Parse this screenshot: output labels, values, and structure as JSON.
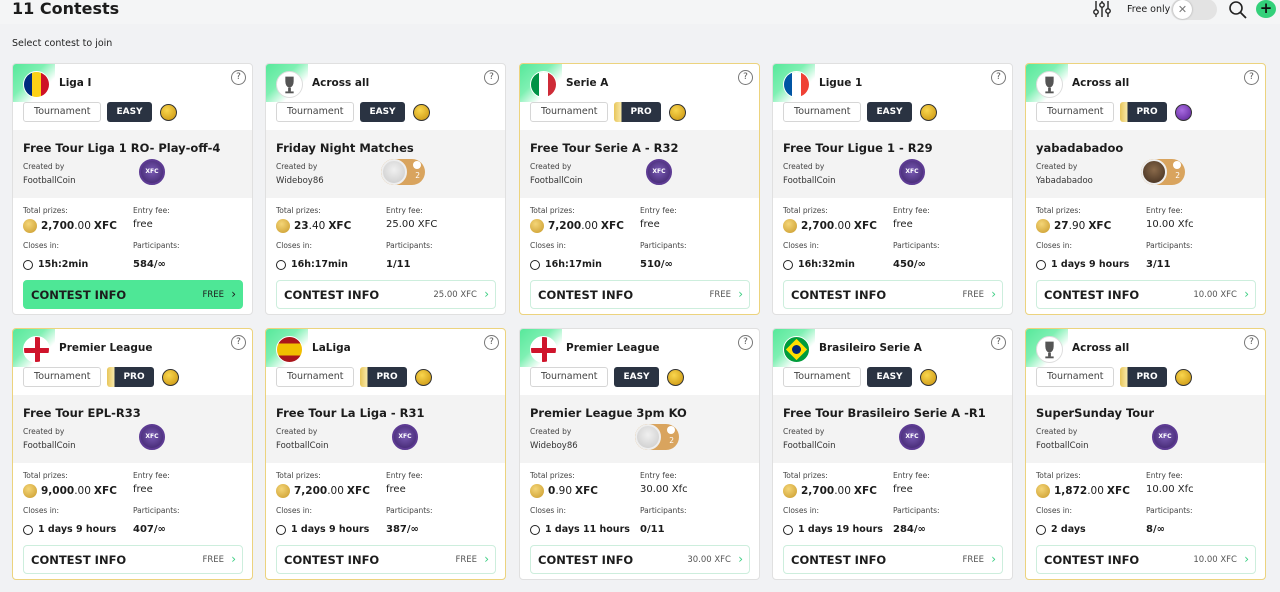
{
  "header": {
    "title": "11 Contests",
    "subtitle": "Select contest to join",
    "free_only_label": "Free only",
    "add_label": "+"
  },
  "labels": {
    "created_by": "Created by",
    "total_prizes": "Total prizes:",
    "entry_fee": "Entry fee:",
    "closes_in": "Closes in:",
    "participants": "Participants:",
    "contest_info": "CONTEST INFO",
    "currency": "XFC",
    "help": "?"
  },
  "contests": [
    {
      "league": "Liga I",
      "flag": "ro",
      "type": "Tournament",
      "level": "EASY",
      "title": "Free Tour Liga 1 RO- Play-off-4",
      "creator": "FootballCoin",
      "avatar": "fc",
      "prize_int": "2,700",
      "prize_dec": ".00",
      "entry_fee": "free",
      "closes": "15h:2min",
      "participants": "584/∞",
      "cta_fee": "FREE",
      "active": true
    },
    {
      "league": "Across all",
      "flag": "cup",
      "type": "Tournament",
      "level": "EASY",
      "title": "Friday Night Matches",
      "creator": "Wideboy86",
      "avatar": "user",
      "avatar_num": "2",
      "prize_int": "23",
      "prize_dec": ".40",
      "entry_fee": "25.00 XFC",
      "closes": "16h:17min",
      "participants": "1/11",
      "cta_fee": "25.00 XFC",
      "active": false
    },
    {
      "league": "Serie A",
      "flag": "it",
      "type": "Tournament",
      "level": "PRO",
      "title": "Free Tour Serie A - R32",
      "creator": "FootballCoin",
      "avatar": "fc",
      "prize_int": "7,200",
      "prize_dec": ".00",
      "entry_fee": "free",
      "closes": "16h:17min",
      "participants": "510/∞",
      "cta_fee": "FREE",
      "active": false
    },
    {
      "league": "Ligue 1",
      "flag": "fr",
      "type": "Tournament",
      "level": "EASY",
      "title": "Free Tour Ligue 1 - R29",
      "creator": "FootballCoin",
      "avatar": "fc",
      "prize_int": "2,700",
      "prize_dec": ".00",
      "entry_fee": "free",
      "closes": "16h:32min",
      "participants": "450/∞",
      "cta_fee": "FREE",
      "active": false
    },
    {
      "league": "Across all",
      "flag": "cup",
      "type": "Tournament",
      "level": "PRO",
      "title": "yabadabadoo",
      "creator": "Yabadabadoo",
      "avatar": "photo",
      "avatar_num": "2",
      "prize_int": "27",
      "prize_dec": ".90",
      "entry_fee": "10.00 Xfc",
      "closes": "1 days 9 hours",
      "participants": "3/11",
      "cta_fee": "10.00 XFC",
      "active": false,
      "purple_badge": true
    },
    {
      "league": "Premier League",
      "flag": "en",
      "type": "Tournament",
      "level": "PRO",
      "title": "Free Tour EPL-R33",
      "creator": "FootballCoin",
      "avatar": "fc",
      "prize_int": "9,000",
      "prize_dec": ".00",
      "entry_fee": "free",
      "closes": "1 days 9 hours",
      "participants": "407/∞",
      "cta_fee": "FREE",
      "active": false
    },
    {
      "league": "LaLiga",
      "flag": "es",
      "type": "Tournament",
      "level": "PRO",
      "title": "Free Tour La Liga - R31",
      "creator": "FootballCoin",
      "avatar": "fc",
      "prize_int": "7,200",
      "prize_dec": ".00",
      "entry_fee": "free",
      "closes": "1 days 9 hours",
      "participants": "387/∞",
      "cta_fee": "FREE",
      "active": false
    },
    {
      "league": "Premier League",
      "flag": "en",
      "type": "Tournament",
      "level": "EASY",
      "title": "Premier League 3pm KO",
      "creator": "Wideboy86",
      "avatar": "user",
      "avatar_num": "2",
      "prize_int": "0",
      "prize_dec": ".90",
      "entry_fee": "30.00 Xfc",
      "closes": "1 days 11 hours",
      "participants": "0/11",
      "cta_fee": "30.00 XFC",
      "active": false
    },
    {
      "league": "Brasileiro Serie A",
      "flag": "br",
      "type": "Tournament",
      "level": "EASY",
      "title": "Free Tour Brasileiro Serie A -R1",
      "creator": "FootballCoin",
      "avatar": "fc",
      "prize_int": "2,700",
      "prize_dec": ".00",
      "entry_fee": "free",
      "closes": "1 days 19 hours",
      "participants": "284/∞",
      "cta_fee": "FREE",
      "active": false
    },
    {
      "league": "Across all",
      "flag": "cup",
      "type": "Tournament",
      "level": "PRO",
      "title": "SuperSunday Tour",
      "creator": "FootballCoin",
      "avatar": "fc",
      "prize_int": "1,872",
      "prize_dec": ".00",
      "entry_fee": "10.00 Xfc",
      "closes": "2 days",
      "participants": "8/∞",
      "cta_fee": "10.00 XFC",
      "active": false
    }
  ],
  "colors": {
    "accent_green": "#4ee796",
    "chip_dark": "#2a3342",
    "pro_border": "#ecd37e",
    "fc_purple": "#5d3b93"
  }
}
